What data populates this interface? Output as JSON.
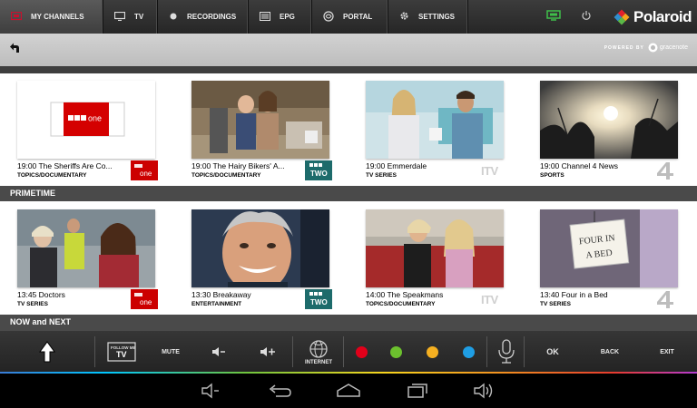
{
  "nav": {
    "tabs": [
      {
        "label": "MY CHANNELS",
        "icon": "my-channels-icon",
        "active": true
      },
      {
        "label": "TV",
        "icon": "tv-icon"
      },
      {
        "label": "RECORDINGS",
        "icon": "record-icon"
      },
      {
        "label": "EPG",
        "icon": "epg-icon"
      },
      {
        "label": "PORTAL",
        "icon": "portal-icon"
      },
      {
        "label": "SETTINGS",
        "icon": "settings-icon"
      }
    ],
    "screen_icon": "screen-icon",
    "power_icon": "power-icon",
    "brand": "Polaroid",
    "accent_color": "#c8102e"
  },
  "toolbar": {
    "back_icon": "back-arrow-icon",
    "powered_by": "POWERED BY",
    "provider": "gracenote"
  },
  "row1": {
    "cards": [
      {
        "title": "19:00 The Sheriffs Are Co...",
        "genre": "TOPICS/DOCUMENTARY",
        "channel": "bbc-one"
      },
      {
        "title": "19:00 The Hairy Bikers' A...",
        "genre": "TOPICS/DOCUMENTARY",
        "channel": "bbc-two"
      },
      {
        "title": "19:00 Emmerdale",
        "genre": "TV SERIES",
        "channel": "itv"
      },
      {
        "title": "19:00 Channel 4 News",
        "genre": "SPORTS",
        "channel": "channel-4"
      }
    ]
  },
  "sections": {
    "primetime": "PRIMETIME",
    "now_next": "NOW and NEXT"
  },
  "row2": {
    "cards": [
      {
        "title": "13:45 Doctors",
        "genre": "TV SERIES",
        "channel": "bbc-one"
      },
      {
        "title": "13:30 Breakaway",
        "genre": "ENTERTAINMENT",
        "channel": "bbc-two"
      },
      {
        "title": "14:00 The Speakmans",
        "genre": "TOPICS/DOCUMENTARY",
        "channel": "itv"
      },
      {
        "title": "13:40 Four in a Bed",
        "genre": "TV SERIES",
        "channel": "channel-4"
      }
    ],
    "sign_text": [
      "FOUR IN",
      "A BED"
    ]
  },
  "channel_logos": {
    "bbc_one": [
      "BBC",
      "one"
    ],
    "bbc_two": [
      "BBC",
      "TWO"
    ],
    "itv": "ITV",
    "bbc_color": "#cc0000",
    "bbc_two_color": "#1d6b6b"
  },
  "remote": {
    "follow_me": [
      "FOLLOW ME",
      "TV"
    ],
    "mute": "MUTE",
    "vol_down": "◀-",
    "vol_up": "◀+",
    "internet": "INTERNET",
    "color_keys": [
      "#e2001a",
      "#6cc12e",
      "#f5b021",
      "#1f9ee4"
    ],
    "ok": "OK",
    "back": "BACK",
    "exit": "EXIT"
  }
}
